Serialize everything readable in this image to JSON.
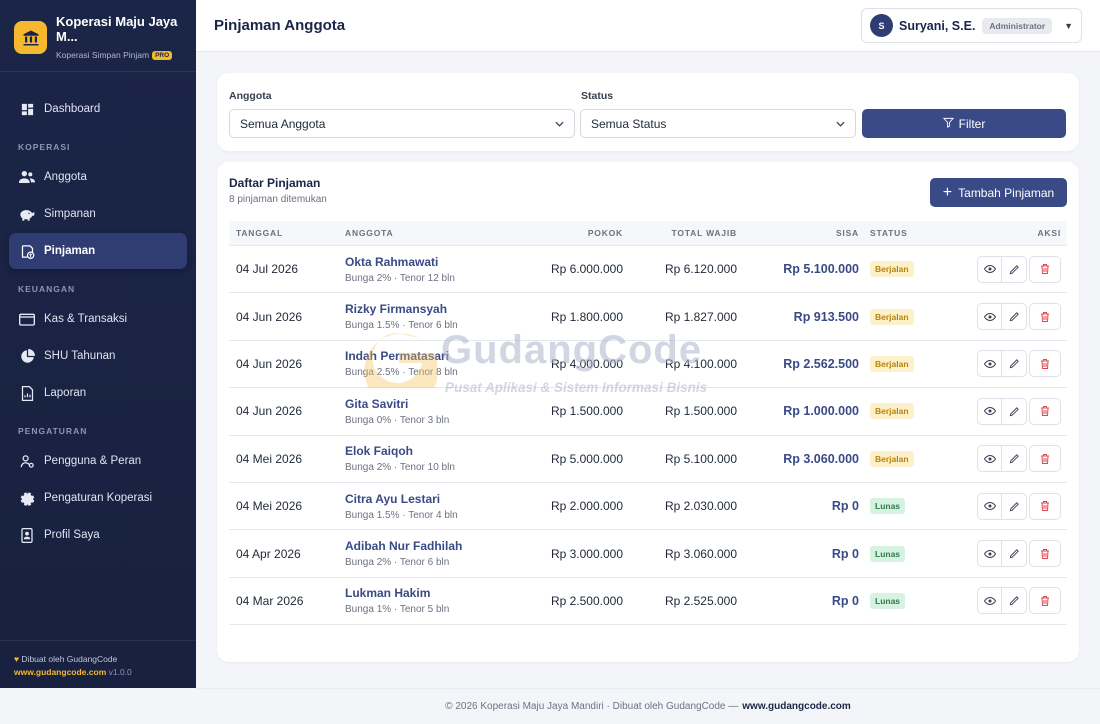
{
  "brand": {
    "title": "Koperasi Maju Jaya M...",
    "subtitle": "Koperasi Simpan Pinjam",
    "badge": "PRO"
  },
  "sidebar": {
    "dashboard": "Dashboard",
    "section_koperasi": "KOPERASI",
    "anggota": "Anggota",
    "simpanan": "Simpanan",
    "pinjaman": "Pinjaman",
    "section_keuangan": "KEUANGAN",
    "kas": "Kas & Transaksi",
    "shu": "SHU Tahunan",
    "laporan": "Laporan",
    "section_pengaturan": "PENGATURAN",
    "pengguna": "Pengguna & Peran",
    "pengaturan": "Pengaturan Koperasi",
    "profil": "Profil Saya",
    "footer_credit": "Dibuat oleh GudangCode",
    "footer_url": "www.gudangcode.com",
    "footer_version": "v1.0.0"
  },
  "header": {
    "title": "Pinjaman Anggota",
    "user_initial": "S",
    "user_name": "Suryani, S.E.",
    "user_role": "Administrator"
  },
  "filter": {
    "anggota_label": "Anggota",
    "anggota_value": "Semua Anggota",
    "status_label": "Status",
    "status_value": "Semua Status",
    "button": "Filter"
  },
  "list": {
    "title": "Daftar Pinjaman",
    "subtitle": "8 pinjaman ditemukan",
    "add_button": "Tambah Pinjaman",
    "columns": {
      "tanggal": "TANGGAL",
      "anggota": "ANGGOTA",
      "pokok": "POKOK",
      "total": "TOTAL WAJIB",
      "sisa": "SISA",
      "status": "STATUS",
      "aksi": "AKSI"
    },
    "rows": [
      {
        "date": "04 Jul 2026",
        "name": "Okta Rahmawati",
        "meta": "Bunga 2% · Tenor 12 bln",
        "pokok": "Rp 6.000.000",
        "total": "Rp 6.120.000",
        "sisa": "Rp 5.100.000",
        "status": "Berjalan",
        "status_type": "berjalan"
      },
      {
        "date": "04 Jun 2026",
        "name": "Rizky Firmansyah",
        "meta": "Bunga 1.5% · Tenor 6 bln",
        "pokok": "Rp 1.800.000",
        "total": "Rp 1.827.000",
        "sisa": "Rp 913.500",
        "status": "Berjalan",
        "status_type": "berjalan"
      },
      {
        "date": "04 Jun 2026",
        "name": "Indah Permatasari",
        "meta": "Bunga 2.5% · Tenor 8 bln",
        "pokok": "Rp 4.000.000",
        "total": "Rp 4.100.000",
        "sisa": "Rp 2.562.500",
        "status": "Berjalan",
        "status_type": "berjalan"
      },
      {
        "date": "04 Jun 2026",
        "name": "Gita Savitri",
        "meta": "Bunga 0% · Tenor 3 bln",
        "pokok": "Rp 1.500.000",
        "total": "Rp 1.500.000",
        "sisa": "Rp 1.000.000",
        "status": "Berjalan",
        "status_type": "berjalan"
      },
      {
        "date": "04 Mei 2026",
        "name": "Elok Faiqoh",
        "meta": "Bunga 2% · Tenor 10 bln",
        "pokok": "Rp 5.000.000",
        "total": "Rp 5.100.000",
        "sisa": "Rp 3.060.000",
        "status": "Berjalan",
        "status_type": "berjalan"
      },
      {
        "date": "04 Mei 2026",
        "name": "Citra Ayu Lestari",
        "meta": "Bunga 1.5% · Tenor 4 bln",
        "pokok": "Rp 2.000.000",
        "total": "Rp 2.030.000",
        "sisa": "Rp 0",
        "status": "Lunas",
        "status_type": "lunas"
      },
      {
        "date": "04 Apr 2026",
        "name": "Adibah Nur Fadhilah",
        "meta": "Bunga 2% · Tenor 6 bln",
        "pokok": "Rp 3.000.000",
        "total": "Rp 3.060.000",
        "sisa": "Rp 0",
        "status": "Lunas",
        "status_type": "lunas"
      },
      {
        "date": "04 Mar 2026",
        "name": "Lukman Hakim",
        "meta": "Bunga 1% · Tenor 5 bln",
        "pokok": "Rp 2.500.000",
        "total": "Rp 2.525.000",
        "sisa": "Rp 0",
        "status": "Lunas",
        "status_type": "lunas"
      }
    ]
  },
  "watermark": {
    "title": "GudangCode",
    "subtitle": "Pusat Aplikasi & Sistem Informasi Bisnis"
  },
  "footer": {
    "text": "© 2026 Koperasi Maju Jaya Mandiri · Dibuat oleh GudangCode —",
    "link": "www.gudangcode.com"
  },
  "colors": {
    "sidebar_bg": "#1b2547",
    "accent": "#3a4a86",
    "brand_gold": "#f5b82e",
    "badge_berjalan": "#fdf1c9",
    "badge_lunas": "#d8f2e2",
    "delete_red": "#e0474c"
  },
  "icons": {
    "brand": "bank-icon",
    "dashboard": "dashboard-icon",
    "anggota": "users-icon",
    "simpanan": "piggy-bank-icon",
    "pinjaman": "loan-icon",
    "kas": "wallet-icon",
    "shu": "pie-chart-icon",
    "laporan": "report-icon",
    "pengguna": "user-roles-icon",
    "pengaturan": "gear-icon",
    "profil": "profile-card-icon",
    "view": "eye-icon",
    "edit": "pencil-icon",
    "delete": "trash-icon",
    "filter": "funnel-icon"
  }
}
